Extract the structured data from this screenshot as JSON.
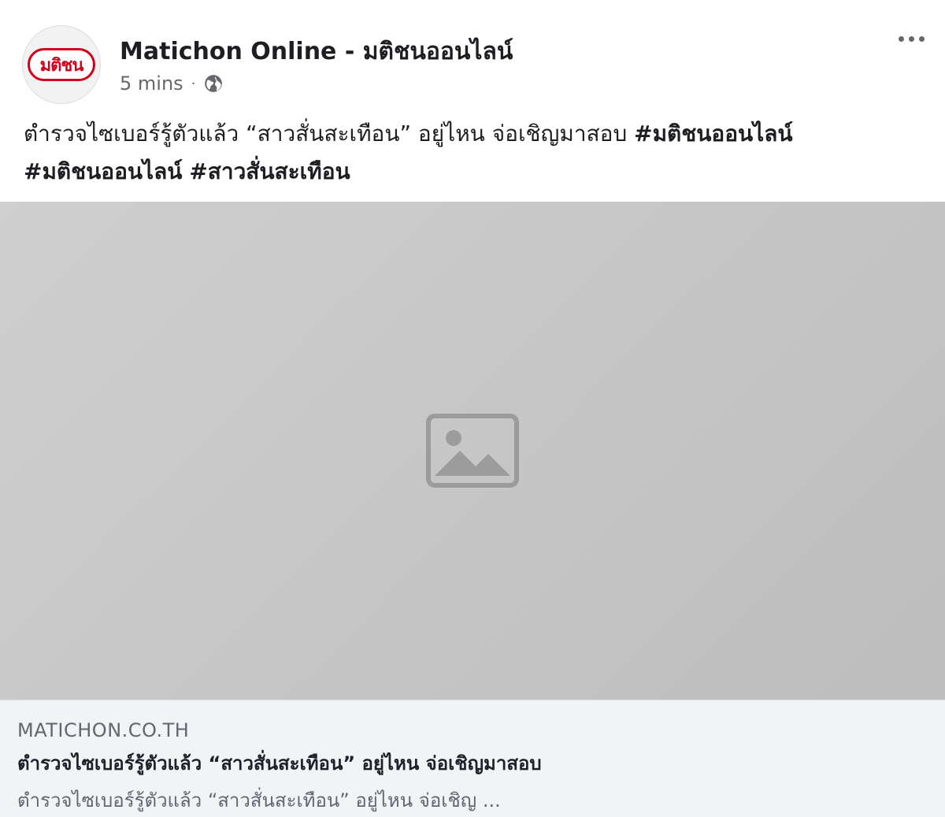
{
  "post": {
    "page_name": "Matichon Online - มติชนออนไลน์",
    "avatar_text": "มติชน",
    "timestamp": "5 mins",
    "separator": "·",
    "privacy_icon": "globe-icon",
    "more_icon": "more-options-icon",
    "text_main": "ตำรวจไซเบอร์รู้ตัวแล้ว “สาวสั่นสะเทือน” อยู่ไหน จ่อเชิญมาสอบ  ",
    "hashtags_line1": "#มติชนออนไลน์",
    "hashtags_line2_a": "#มติชนออนไลน์",
    "hashtags_line2_b": "#สาวสั่นสะเทือน"
  },
  "link_preview": {
    "domain": "MATICHON.CO.TH",
    "title": "ตำรวจไซเบอร์รู้ตัวแล้ว “สาวสั่นสะเทือน” อยู่ไหน จ่อเชิญมาสอบ",
    "description": "ตำรวจไซเบอร์รู้ตัวแล้ว “สาวสั่นสะเทือน” อยู่ไหน จ่อเชิญ ...",
    "image_icon": "image-placeholder-icon"
  },
  "colors": {
    "text_primary": "#1c1e21",
    "text_secondary": "#65676b",
    "card_background": "#f2f3f5",
    "brand_red": "#d0021b"
  }
}
